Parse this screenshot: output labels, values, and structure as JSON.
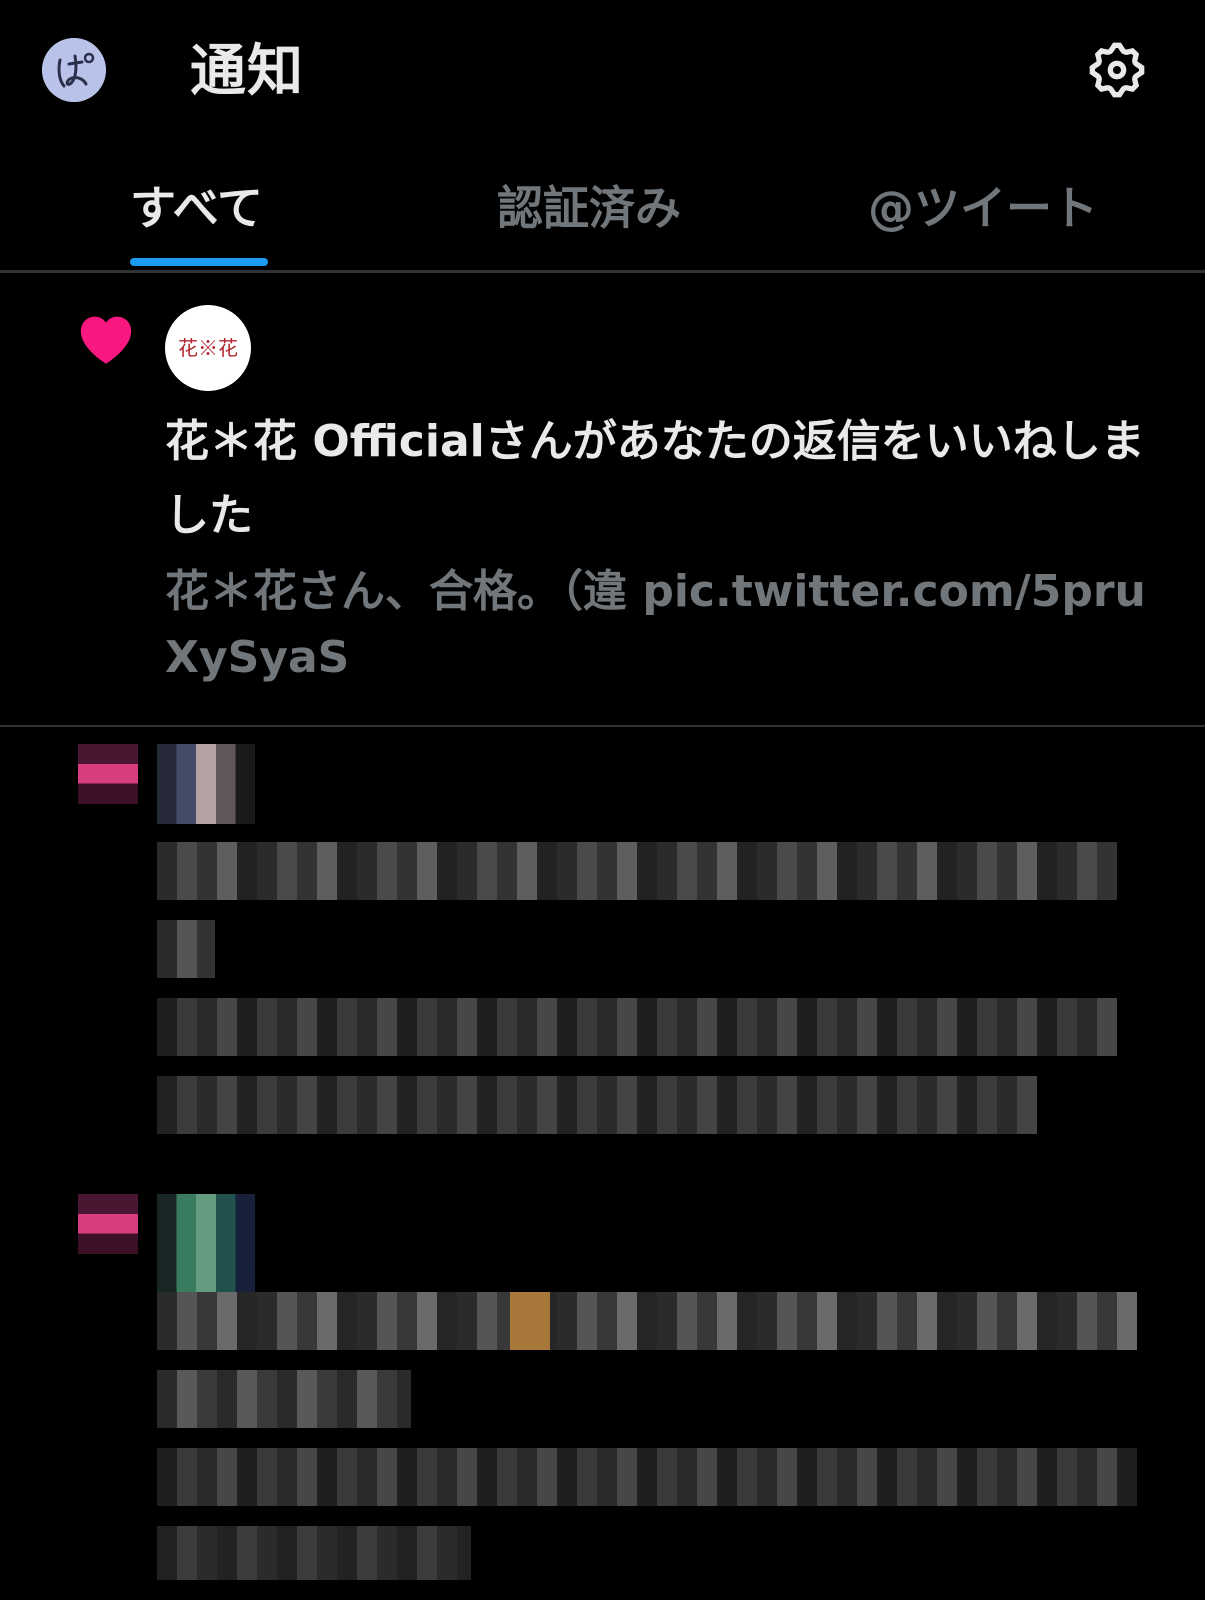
{
  "header": {
    "title": "通知",
    "avatar_icon": "user-avatar-icon",
    "settings_icon": "gear-icon"
  },
  "tabs": [
    {
      "label": "すべて",
      "active": true
    },
    {
      "label": "認証済み",
      "active": false
    },
    {
      "label": "@ツイート",
      "active": false
    }
  ],
  "notifications": [
    {
      "type": "like",
      "icon": "heart-icon",
      "icon_color": "#f91880",
      "avatar_text": "花※花",
      "text": "花＊花 Officialさんがあなたの返信をいいねしました",
      "preview": "花＊花さん、合格。（違 pic.twitter.com/5pruXySyaS"
    }
  ],
  "colors": {
    "background": "#000000",
    "primary_text": "#e7e9ea",
    "secondary_text": "#71767b",
    "accent": "#1d9bf0",
    "divider": "#2f3336"
  }
}
